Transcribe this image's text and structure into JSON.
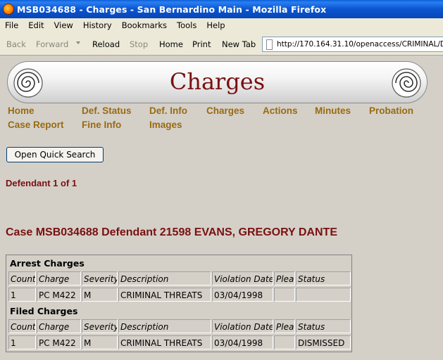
{
  "window": {
    "title": "MSB034688 - Charges - San Bernardino Main - Mozilla Firefox"
  },
  "menu": [
    "File",
    "Edit",
    "View",
    "History",
    "Bookmarks",
    "Tools",
    "Help"
  ],
  "toolbar": {
    "back": "Back",
    "forward": "Forward",
    "reload": "Reload",
    "stop": "Stop",
    "home": "Home",
    "print": "Print",
    "new_tab": "New Tab",
    "url": "http://170.164.31.10/openaccess/CRIMINAL/D"
  },
  "page": {
    "heading": "Charges",
    "nav_links": [
      "Home",
      "Def. Status",
      "Def. Info",
      "Charges",
      "Actions",
      "Minutes",
      "Probation",
      "Case Report",
      "Fine Info",
      "Images"
    ],
    "quick_search_button": "Open Quick Search",
    "defendant_count": "Defendant 1 of 1",
    "case_heading": "Case MSB034688 Defendant 21598 EVANS, GREGORY DANTE",
    "colors": {
      "heading": "#7a1010",
      "nav_link": "#9a6a10",
      "title_bar": "#0a55d0"
    }
  },
  "charges": {
    "columns": [
      "Count",
      "Charge",
      "Severity",
      "Description",
      "Violation Date",
      "Plea",
      "Status"
    ],
    "arrest_label": "Arrest Charges",
    "arrest_rows": [
      [
        "1",
        "PC M422",
        "M",
        "CRIMINAL THREATS",
        "03/04/1998",
        "",
        ""
      ]
    ],
    "filed_label": "Filed Charges",
    "filed_rows": [
      [
        "1",
        "PC M422",
        "M",
        "CRIMINAL THREATS",
        "03/04/1998",
        "",
        "DISMISSED"
      ]
    ]
  }
}
